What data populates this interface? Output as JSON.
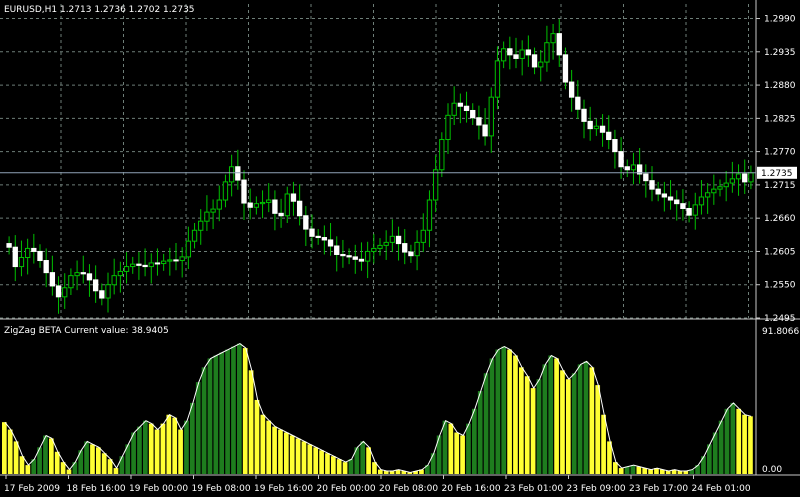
{
  "chart_data": [
    {
      "type": "candlestick",
      "title": "EURUSD,H1  1.2713 1.2736 1.2702 1.2735",
      "symbol": "EURUSD,H1",
      "ohlc": [
        1.2713,
        1.2736,
        1.2702,
        1.2735
      ],
      "ylim": [
        1.2495,
        1.3014
      ],
      "yticks": [
        "1.2990",
        "1.2935",
        "1.2880",
        "1.2825",
        "1.2770",
        "1.2715",
        "1.2660",
        "1.2605",
        "1.2550",
        "1.2495"
      ],
      "current_price_label": "1.2735",
      "current_price": 1.2735,
      "grid": true,
      "colors": {
        "bull": "#00c000",
        "bear": "#ffffff",
        "wick": "#00c000",
        "current_line": "#8fa3b8",
        "grid": "#6e7e78"
      },
      "closes": [
        1.2612,
        1.258,
        1.2595,
        1.261,
        1.2605,
        1.259,
        1.257,
        1.2548,
        1.253,
        1.2545,
        1.2565,
        1.257,
        1.2568,
        1.2558,
        1.254,
        1.2528,
        1.255,
        1.2565,
        1.2572,
        1.258,
        1.2584,
        1.2582,
        1.258,
        1.2586,
        1.2585,
        1.2589,
        1.2591,
        1.259,
        1.2596,
        1.2622,
        1.264,
        1.2655,
        1.267,
        1.2675,
        1.269,
        1.272,
        1.2745,
        1.2723,
        1.2685,
        1.2678,
        1.2684,
        1.2686,
        1.269,
        1.2668,
        1.2664,
        1.27,
        1.2688,
        1.2664,
        1.2642,
        1.263,
        1.2628,
        1.2624,
        1.2614,
        1.26,
        1.2598,
        1.2596,
        1.2592,
        1.2589,
        1.2605,
        1.261,
        1.2615,
        1.262,
        1.263,
        1.2618,
        1.2604,
        1.2598,
        1.262,
        1.264,
        1.269,
        1.274,
        1.279,
        1.283,
        1.285,
        1.2845,
        1.2838,
        1.2826,
        1.2814,
        1.2796,
        1.286,
        1.292,
        1.294,
        1.293,
        1.2924,
        1.2938,
        1.293,
        1.291,
        1.2918,
        1.295,
        1.2965,
        1.293,
        1.2885,
        1.286,
        1.284,
        1.282,
        1.2808,
        1.2812,
        1.2802,
        1.279,
        1.277,
        1.2745,
        1.274,
        1.2748,
        1.2733,
        1.2722,
        1.2708,
        1.27,
        1.2695,
        1.269,
        1.2684,
        1.2676,
        1.2665,
        1.2682,
        1.2695,
        1.2702,
        1.2708,
        1.2712,
        1.2718,
        1.2725,
        1.2733,
        1.272,
        1.2735
      ]
    },
    {
      "type": "bar",
      "title": "ZigZag BETA Current value: 38.9405",
      "yticks": [
        "91.8066",
        "0.00"
      ],
      "ylim": [
        0,
        91.8066
      ],
      "colors": {
        "up": "#1e7d1e",
        "down": "#ffff33",
        "line": "#ffffff"
      },
      "bars": [
        {
          "v": 35,
          "c": "down"
        },
        {
          "v": 30,
          "c": "down"
        },
        {
          "v": 22,
          "c": "down"
        },
        {
          "v": 12,
          "c": "down"
        },
        {
          "v": 6,
          "c": "down"
        },
        {
          "v": 10,
          "c": "up"
        },
        {
          "v": 18,
          "c": "up"
        },
        {
          "v": 26,
          "c": "up"
        },
        {
          "v": 24,
          "c": "down"
        },
        {
          "v": 15,
          "c": "down"
        },
        {
          "v": 8,
          "c": "down"
        },
        {
          "v": 3,
          "c": "down"
        },
        {
          "v": 8,
          "c": "up"
        },
        {
          "v": 16,
          "c": "up"
        },
        {
          "v": 22,
          "c": "up"
        },
        {
          "v": 20,
          "c": "down"
        },
        {
          "v": 18,
          "c": "down"
        },
        {
          "v": 14,
          "c": "down"
        },
        {
          "v": 10,
          "c": "down"
        },
        {
          "v": 4,
          "c": "down"
        },
        {
          "v": 12,
          "c": "up"
        },
        {
          "v": 20,
          "c": "up"
        },
        {
          "v": 28,
          "c": "up"
        },
        {
          "v": 32,
          "c": "up"
        },
        {
          "v": 36,
          "c": "up"
        },
        {
          "v": 34,
          "c": "down"
        },
        {
          "v": 30,
          "c": "down"
        },
        {
          "v": 34,
          "c": "down"
        },
        {
          "v": 40,
          "c": "down"
        },
        {
          "v": 38,
          "c": "down"
        },
        {
          "v": 30,
          "c": "down"
        },
        {
          "v": 36,
          "c": "up"
        },
        {
          "v": 48,
          "c": "up"
        },
        {
          "v": 62,
          "c": "up"
        },
        {
          "v": 72,
          "c": "up"
        },
        {
          "v": 78,
          "c": "up"
        },
        {
          "v": 80,
          "c": "up"
        },
        {
          "v": 82,
          "c": "up"
        },
        {
          "v": 84,
          "c": "up"
        },
        {
          "v": 86,
          "c": "up"
        },
        {
          "v": 88,
          "c": "up"
        },
        {
          "v": 85,
          "c": "down"
        },
        {
          "v": 70,
          "c": "down"
        },
        {
          "v": 50,
          "c": "down"
        },
        {
          "v": 40,
          "c": "down"
        },
        {
          "v": 36,
          "c": "down"
        },
        {
          "v": 32,
          "c": "down"
        },
        {
          "v": 30,
          "c": "down"
        },
        {
          "v": 28,
          "c": "down"
        },
        {
          "v": 26,
          "c": "down"
        },
        {
          "v": 24,
          "c": "down"
        },
        {
          "v": 22,
          "c": "down"
        },
        {
          "v": 20,
          "c": "down"
        },
        {
          "v": 18,
          "c": "down"
        },
        {
          "v": 16,
          "c": "down"
        },
        {
          "v": 14,
          "c": "down"
        },
        {
          "v": 12,
          "c": "down"
        },
        {
          "v": 10,
          "c": "down"
        },
        {
          "v": 8,
          "c": "down"
        },
        {
          "v": 10,
          "c": "up"
        },
        {
          "v": 18,
          "c": "up"
        },
        {
          "v": 22,
          "c": "up"
        },
        {
          "v": 18,
          "c": "down"
        },
        {
          "v": 8,
          "c": "down"
        },
        {
          "v": 3,
          "c": "down"
        },
        {
          "v": 2,
          "c": "down"
        },
        {
          "v": 2,
          "c": "down"
        },
        {
          "v": 3,
          "c": "down"
        },
        {
          "v": 2,
          "c": "down"
        },
        {
          "v": 1,
          "c": "down"
        },
        {
          "v": 2,
          "c": "down"
        },
        {
          "v": 3,
          "c": "down"
        },
        {
          "v": 6,
          "c": "up"
        },
        {
          "v": 14,
          "c": "up"
        },
        {
          "v": 26,
          "c": "up"
        },
        {
          "v": 36,
          "c": "up"
        },
        {
          "v": 34,
          "c": "down"
        },
        {
          "v": 28,
          "c": "down"
        },
        {
          "v": 26,
          "c": "down"
        },
        {
          "v": 34,
          "c": "up"
        },
        {
          "v": 44,
          "c": "up"
        },
        {
          "v": 56,
          "c": "up"
        },
        {
          "v": 68,
          "c": "up"
        },
        {
          "v": 78,
          "c": "up"
        },
        {
          "v": 84,
          "c": "up"
        },
        {
          "v": 86,
          "c": "up"
        },
        {
          "v": 84,
          "c": "down"
        },
        {
          "v": 80,
          "c": "down"
        },
        {
          "v": 72,
          "c": "down"
        },
        {
          "v": 66,
          "c": "down"
        },
        {
          "v": 58,
          "c": "down"
        },
        {
          "v": 64,
          "c": "up"
        },
        {
          "v": 74,
          "c": "up"
        },
        {
          "v": 80,
          "c": "up"
        },
        {
          "v": 78,
          "c": "down"
        },
        {
          "v": 70,
          "c": "down"
        },
        {
          "v": 64,
          "c": "down"
        },
        {
          "v": 68,
          "c": "up"
        },
        {
          "v": 74,
          "c": "up"
        },
        {
          "v": 76,
          "c": "up"
        },
        {
          "v": 72,
          "c": "down"
        },
        {
          "v": 60,
          "c": "down"
        },
        {
          "v": 40,
          "c": "down"
        },
        {
          "v": 22,
          "c": "down"
        },
        {
          "v": 8,
          "c": "down"
        },
        {
          "v": 4,
          "c": "down"
        },
        {
          "v": 5,
          "c": "up"
        },
        {
          "v": 6,
          "c": "up"
        },
        {
          "v": 5,
          "c": "down"
        },
        {
          "v": 4,
          "c": "down"
        },
        {
          "v": 3,
          "c": "down"
        },
        {
          "v": 4,
          "c": "down"
        },
        {
          "v": 3,
          "c": "down"
        },
        {
          "v": 2,
          "c": "down"
        },
        {
          "v": 3,
          "c": "down"
        },
        {
          "v": 2,
          "c": "down"
        },
        {
          "v": 2,
          "c": "down"
        },
        {
          "v": 3,
          "c": "up"
        },
        {
          "v": 6,
          "c": "up"
        },
        {
          "v": 12,
          "c": "up"
        },
        {
          "v": 20,
          "c": "up"
        },
        {
          "v": 28,
          "c": "up"
        },
        {
          "v": 36,
          "c": "up"
        },
        {
          "v": 44,
          "c": "up"
        },
        {
          "v": 48,
          "c": "up"
        },
        {
          "v": 44,
          "c": "down"
        },
        {
          "v": 40,
          "c": "down"
        },
        {
          "v": 38.94,
          "c": "down"
        }
      ]
    }
  ],
  "xaxis": {
    "labels": [
      "17 Feb 2009",
      "18 Feb 16:00",
      "19 Feb 00:00",
      "19 Feb 08:00",
      "19 Feb 16:00",
      "20 Feb 00:00",
      "20 Feb 08:00",
      "20 Feb 16:00",
      "23 Feb 01:00",
      "23 Feb 09:00",
      "23 Feb 17:00",
      "24 Feb 01:00"
    ]
  }
}
